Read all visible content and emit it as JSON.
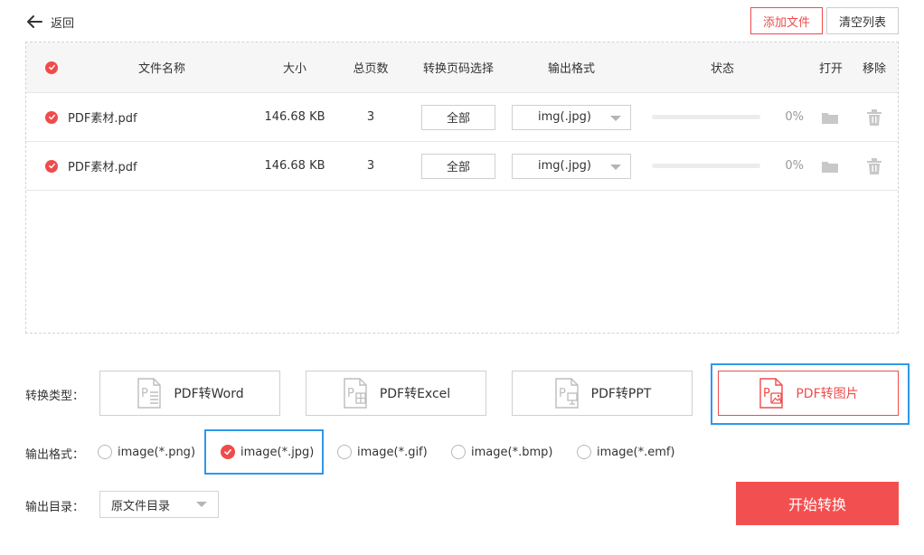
{
  "header": {
    "back_label": "返回",
    "add_file_label": "添加文件",
    "clear_list_label": "清空列表"
  },
  "table": {
    "columns": {
      "name": "文件名称",
      "size": "大小",
      "pages": "总页数",
      "range": "转换页码选择",
      "format": "输出格式",
      "status": "状态",
      "open": "打开",
      "remove": "移除"
    },
    "rows": [
      {
        "name": "PDF素材.pdf",
        "size": "146.68 KB",
        "pages": "3",
        "range": "全部",
        "format": "img(.jpg)",
        "progress": 0,
        "status": "0%"
      },
      {
        "name": "PDF素材.pdf",
        "size": "146.68 KB",
        "pages": "3",
        "range": "全部",
        "format": "img(.jpg)",
        "progress": 0,
        "status": "0%"
      }
    ]
  },
  "convert_type": {
    "label": "转换类型：",
    "options": [
      "PDF转Word",
      "PDF转Excel",
      "PDF转PPT",
      "PDF转图片"
    ],
    "selected": "PDF转图片"
  },
  "output_format": {
    "label": "输出格式：",
    "options": [
      "image(*.png)",
      "image(*.jpg)",
      "image(*.gif)",
      "image(*.bmp)",
      "image(*.emf)"
    ],
    "selected": "image(*.jpg)"
  },
  "output_dir": {
    "label": "输出目录：",
    "value": "原文件目录"
  },
  "start_label": "开始转换",
  "icons": {
    "back": "arrow-left-icon",
    "check": "check-circle-icon",
    "folder": "folder-icon",
    "trash": "trash-icon",
    "word": "pdf-word-icon",
    "excel": "pdf-excel-icon",
    "ppt": "pdf-ppt-icon",
    "image": "pdf-image-icon"
  },
  "colors": {
    "accent": "#f04b4b",
    "focus": "#2f98ea",
    "muted_icon": "#c8c8c8",
    "header_bg": "#f6f6f6"
  }
}
